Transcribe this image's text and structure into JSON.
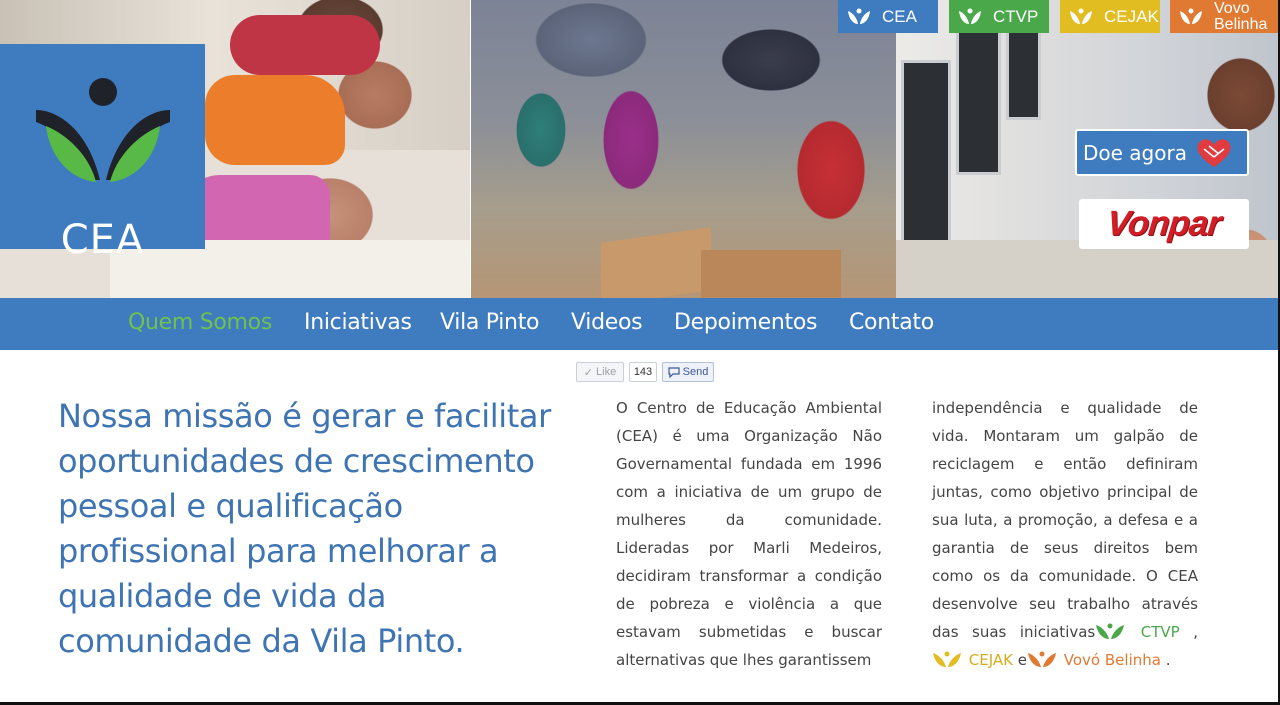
{
  "logo": {
    "text": "CEA"
  },
  "top_tabs": [
    {
      "label": "CEA",
      "icon": "leaves-icon",
      "color": "#3e7bbf"
    },
    {
      "label": "CTVP",
      "icon": "leaves-icon",
      "color": "#4aa84a"
    },
    {
      "label": "CEJAK",
      "icon": "leaves-icon",
      "color": "#e2bd21"
    },
    {
      "label_line1": "Vovo",
      "label_line2": "Belinha",
      "icon": "leaves-icon",
      "color": "#e07a33"
    }
  ],
  "donate": {
    "label": "Doe agora",
    "icon": "heart-hands-icon"
  },
  "sponsor": {
    "label": "Vonpar"
  },
  "nav": {
    "items": [
      "Quem Somos",
      "Iniciativas",
      "Vila Pinto",
      "Videos",
      "Depoimentos",
      "Contato"
    ],
    "active_color": "#6fc24f"
  },
  "social": {
    "like_label": "Like",
    "like_count": "143",
    "send_label": "Send"
  },
  "content": {
    "mission": "Nossa missão é gerar e facilitar oportunidades de crescimento pessoal e qualificação profissional para melhorar a qualidade de vida da comunidade da Vila Pinto.",
    "col1": "O Centro de Educação Ambiental (CEA) é uma Organização Não Governamental fundada em 1996 com a iniciativa de um grupo de mulheres da comunidade. Lideradas por Marli Medeiros, decidiram transformar a condição de pobreza e violência a que estavam submetidas e buscar alternativas que lhes garantissem",
    "col2_text": "independência e qualidade de vida. Montaram um galpão de reciclagem e então definiram juntas, como objetivo principal de sua luta, a promoção, a defesa e a garantia de seus direitos bem como os da comunidade. O CEA desenvolve seu trabalho através das suas iniciativas",
    "links": {
      "ctvp": "CTVP",
      "cejak": "CEJAK",
      "belinha": "Vovó Belinha"
    },
    "sep_comma": " ,",
    "sep_and": " e",
    "end": " ."
  }
}
